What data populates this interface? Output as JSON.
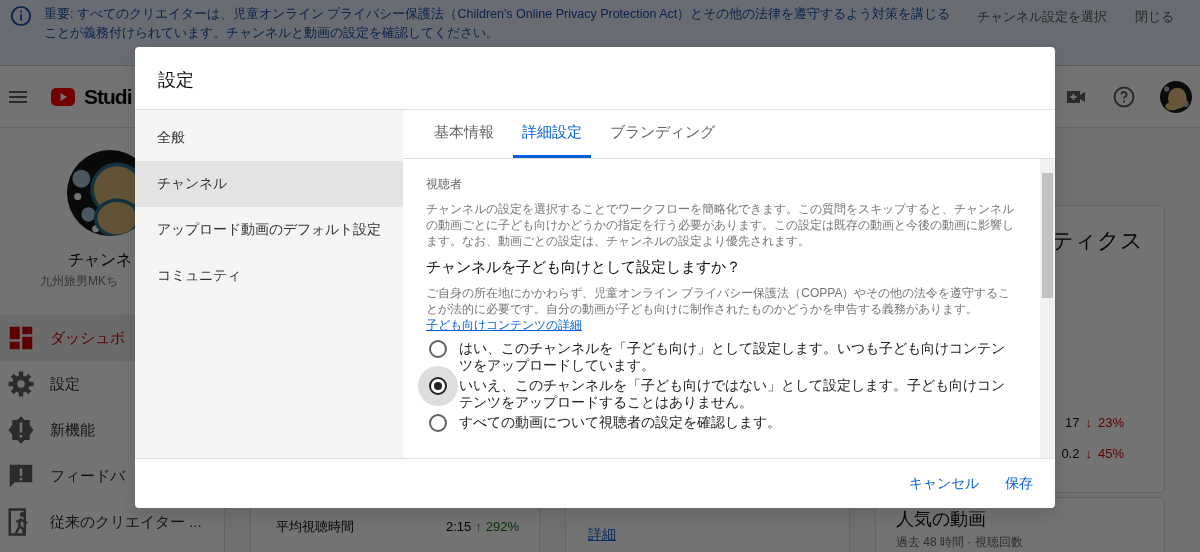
{
  "banner": {
    "text": "重要: すべてのクリエイターは、児童オンライン プライバシー保護法（Children's Online Privacy Protection Act）とその他の法律を遵守するよう対策を講じることが義務付けられています。チャンネルと動画の設定を確認してください。",
    "actions": [
      "チャンネル設定を選択",
      "閉じる"
    ]
  },
  "header": {
    "logo_text": "Studi"
  },
  "sidebar": {
    "channel_title": "チャンネ",
    "channel_name": "九州旅男MKち",
    "items": [
      {
        "kind": "dashboard",
        "label": "ダッシュボ",
        "selected": true
      },
      {
        "kind": "settings",
        "label": "設定",
        "selected": false
      },
      {
        "kind": "whats-new",
        "label": "新機能",
        "selected": false
      },
      {
        "kind": "feedback",
        "label": "フィードバ",
        "selected": false
      },
      {
        "kind": "classic",
        "label": "従来のクリエイター ...",
        "selected": false
      }
    ]
  },
  "dashboard": {
    "analytics_title": "ティクス",
    "metrics": [
      {
        "kind": "down",
        "value": "17",
        "arrow": "↓",
        "change": "23%"
      },
      {
        "kind": "down",
        "value": "0.2",
        "arrow": "↓",
        "change": "45%"
      }
    ],
    "stats": [
      {
        "kind": "up",
        "label": "平均視聴時間",
        "value": "2:15",
        "arrow": "↑",
        "change": "292%"
      }
    ],
    "link": "詳細",
    "top_videos": {
      "title": "人気の動画",
      "subtitle": "過去 48 時間 · 視聴回数"
    }
  },
  "dialog": {
    "title": "設定",
    "nav": [
      {
        "label": "全般",
        "selected": false
      },
      {
        "label": "チャンネル",
        "selected": true
      },
      {
        "label": "アップロード動画のデフォルト設定",
        "selected": false
      },
      {
        "label": "コミュニティ",
        "selected": false
      }
    ],
    "tabs": [
      {
        "label": "基本情報",
        "selected": false
      },
      {
        "label": "詳細設定",
        "selected": true
      },
      {
        "label": "ブランディング",
        "selected": false
      }
    ],
    "section_label": "視聴者",
    "description": "チャンネルの設定を選択することでワークフローを簡略化できます。この質問をスキップすると、チャンネルの動画ごとに子ども向けかどうかの指定を行う必要があります。この設定は既存の動画と今後の動画に影響します。なお、動画ごとの設定は、チャンネルの設定より優先されます。",
    "question": "チャンネルを子ども向けとして設定しますか？",
    "note": "ご自身の所在地にかかわらず、児童オンライン プライバシー保護法（COPPA）やその他の法令を遵守することが法的に必要です。自分の動画が子ども向けに制作されたものかどうかを申告する義務があります。",
    "note_link": "子ども向けコンテンツの詳細",
    "options": [
      {
        "label": "はい、このチャンネルを「子ども向け」として設定します。いつも子ども向けコンテンツをアップロードしています。",
        "selected": false
      },
      {
        "label": "いいえ、このチャンネルを「子ども向けではない」として設定します。子ども向けコンテンツをアップロードすることはありません。",
        "selected": true
      },
      {
        "label": "すべての動画について視聴者の設定を確認します。",
        "selected": false
      }
    ],
    "buttons": [
      "キャンセル",
      "保存"
    ]
  }
}
